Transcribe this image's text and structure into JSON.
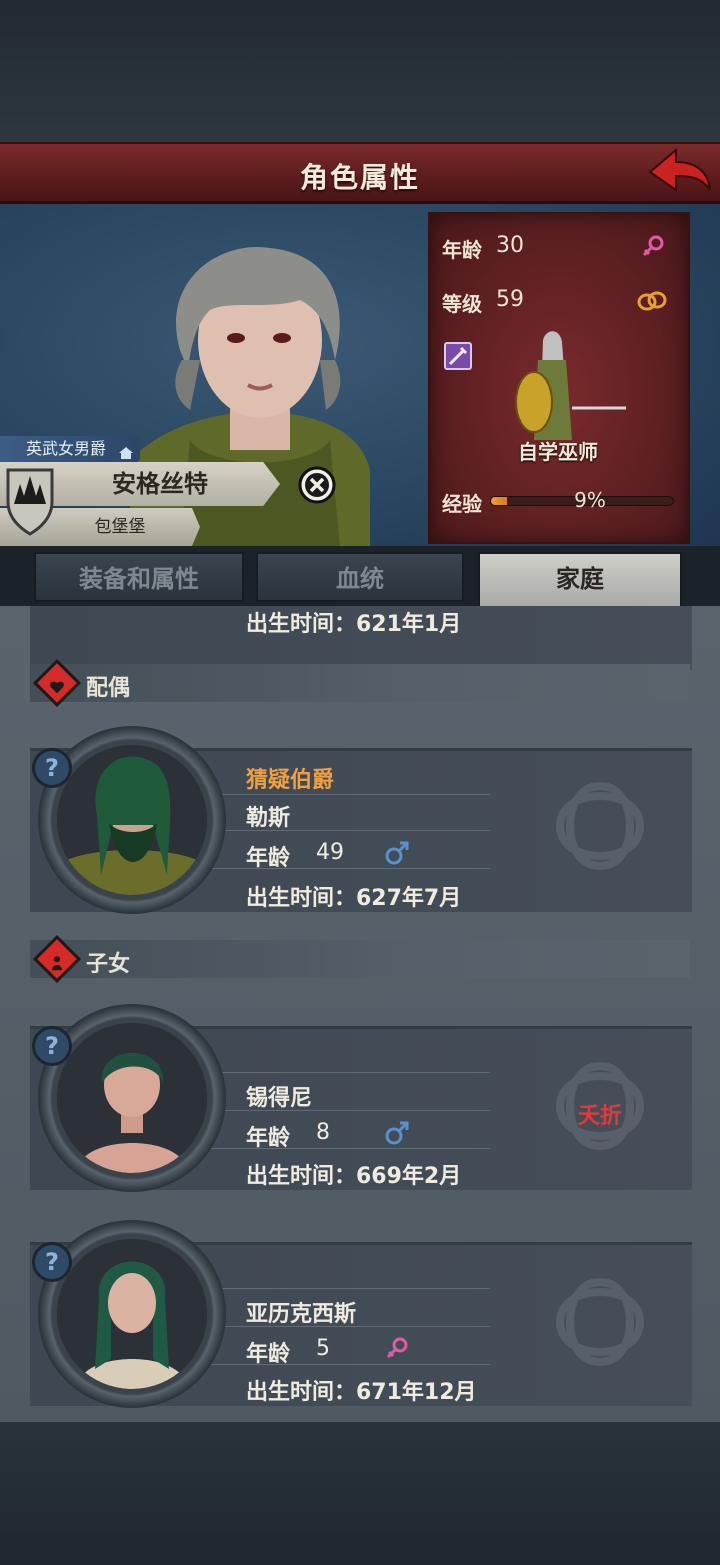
{
  "header": {
    "title": "角色属性"
  },
  "character": {
    "rank_title": "英武女男爵",
    "name": "安格丝特",
    "holding": "包堡堡"
  },
  "stats": {
    "age_label": "年龄",
    "age": "30",
    "level_label": "等级",
    "level": "59",
    "class_name": "自学巫师",
    "xp_label": "经验",
    "xp_percent_text": "9%",
    "xp_fraction": 0.09,
    "gender_icon": "female-icon",
    "marriage_icon": "rings-icon"
  },
  "tabs": [
    {
      "label": "装备和属性",
      "active": false
    },
    {
      "label": "血统",
      "active": false
    },
    {
      "label": "家庭",
      "active": true
    }
  ],
  "partial_card": {
    "birth": "出生时间：621年1月"
  },
  "sections": {
    "spouse_title": "配偶",
    "children_title": "子女"
  },
  "spouse": {
    "title": "猜疑伯爵",
    "name": "勒斯",
    "age_label": "年龄",
    "age": "49",
    "gender": "male",
    "birth": "出生时间：627年7月"
  },
  "children": [
    {
      "name": "锡得尼",
      "age_label": "年龄",
      "age": "8",
      "gender": "male",
      "birth": "出生时间：669年2月",
      "status": "夭折"
    },
    {
      "name": "亚历克西斯",
      "age_label": "年龄",
      "age": "5",
      "gender": "female",
      "birth": "出生时间：671年12月"
    }
  ],
  "colors": {
    "banner": "#5c1c1e",
    "title_orange": "#f0a040",
    "status_red": "#e23a3a",
    "male_blue": "#5a8fd0",
    "female_pink": "#e05aa8"
  }
}
